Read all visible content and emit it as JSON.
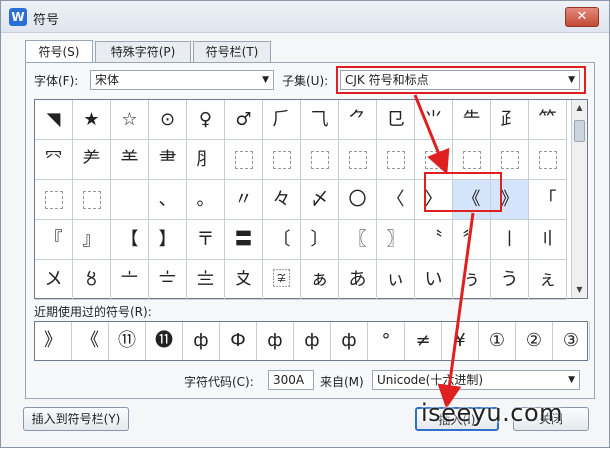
{
  "window": {
    "title": "符号",
    "close": "✕",
    "logo": "W"
  },
  "tabs": [
    {
      "label": "符号(S)"
    },
    {
      "label": "特殊字符(P)"
    },
    {
      "label": "符号栏(T)"
    }
  ],
  "font": {
    "label": "字体(F):",
    "value": "宋体"
  },
  "subset": {
    "label": "子集(U):",
    "value": "CJK 符号和标点"
  },
  "grid": {
    "rows": [
      [
        "◥",
        "★",
        "☆",
        "⊙",
        "♀",
        "♂",
        "⺁",
        "⺄",
        "⺈",
        "⺋",
        "⺌",
        "⺧",
        "⺪",
        "⺮"
      ],
      [
        "⺳",
        "⺶",
        "⺷",
        "⺻",
        "⺼",
        "□",
        "□",
        "□",
        "□",
        "□",
        "□",
        "□",
        "□",
        "□"
      ],
      [
        "□",
        "□",
        "",
        "、",
        "。",
        "〃",
        "々",
        "〆",
        "〇",
        "〈",
        "〉",
        "《",
        "》",
        "「",
        "」"
      ],
      [
        "『",
        "』",
        "【",
        "】",
        "〒",
        "〓",
        "〔",
        "〕",
        "〖",
        "〗",
        "〝",
        "〞",
        "〡",
        "〢",
        "〣"
      ],
      [
        "〤",
        "〥",
        "〦",
        "〧",
        "〨",
        "〩",
        "〾",
        "ぁ",
        "あ",
        "ぃ",
        "い",
        "ぅ",
        "う",
        "ぇ",
        "え"
      ]
    ],
    "selected_row": 2,
    "selected_col": 11
  },
  "recent": {
    "label": "近期使用过的符号(R):",
    "items": [
      "》",
      "《",
      "⑪",
      "⓫",
      "ф",
      "Ф",
      "ф",
      "ф",
      "ф",
      "°",
      "≠",
      "¥",
      "①",
      "②",
      "③"
    ]
  },
  "code": {
    "label": "字符代码(C):",
    "value": "300A"
  },
  "from": {
    "label": "来自(M)",
    "value": "Unicode(十六进制)"
  },
  "buttons": {
    "insert_bar": "插入到符号栏(Y)",
    "insert": "插入(I)",
    "close": "关闭"
  },
  "watermark": "iseeyu.com"
}
